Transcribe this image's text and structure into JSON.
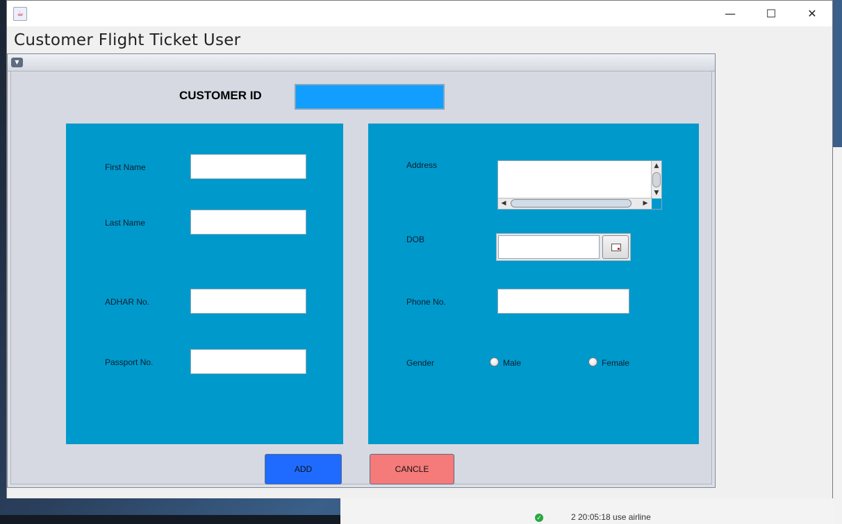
{
  "window": {
    "app_title": "Customer Flight Ticket User",
    "controls": {
      "minimize": "—",
      "maximize": "☐",
      "close": "✕"
    }
  },
  "form": {
    "customer_id_label": "CUSTOMER ID",
    "customer_id_value": "",
    "left_panel": {
      "first_name_label": "First Name",
      "last_name_label": "Last Name",
      "adhar_label": "ADHAR No.",
      "passport_label": "Passport No.",
      "first_name_value": "",
      "last_name_value": "",
      "adhar_value": "",
      "passport_value": ""
    },
    "right_panel": {
      "address_label": "Address",
      "dob_label": "DOB",
      "phone_label": "Phone No.",
      "gender_label": "Gender",
      "gender_options": [
        "Male",
        "Female"
      ],
      "address_value": "",
      "dob_value": "",
      "phone_value": ""
    },
    "buttons": {
      "add": "ADD",
      "cancel": "CANCLE"
    }
  },
  "background": {
    "status_text": "2  20:05:18  use airline"
  },
  "colors": {
    "panel": "#0099cc",
    "customer_id_field": "#119eff",
    "add_button": "#1f6bff",
    "cancel_button": "#f57a7a"
  }
}
